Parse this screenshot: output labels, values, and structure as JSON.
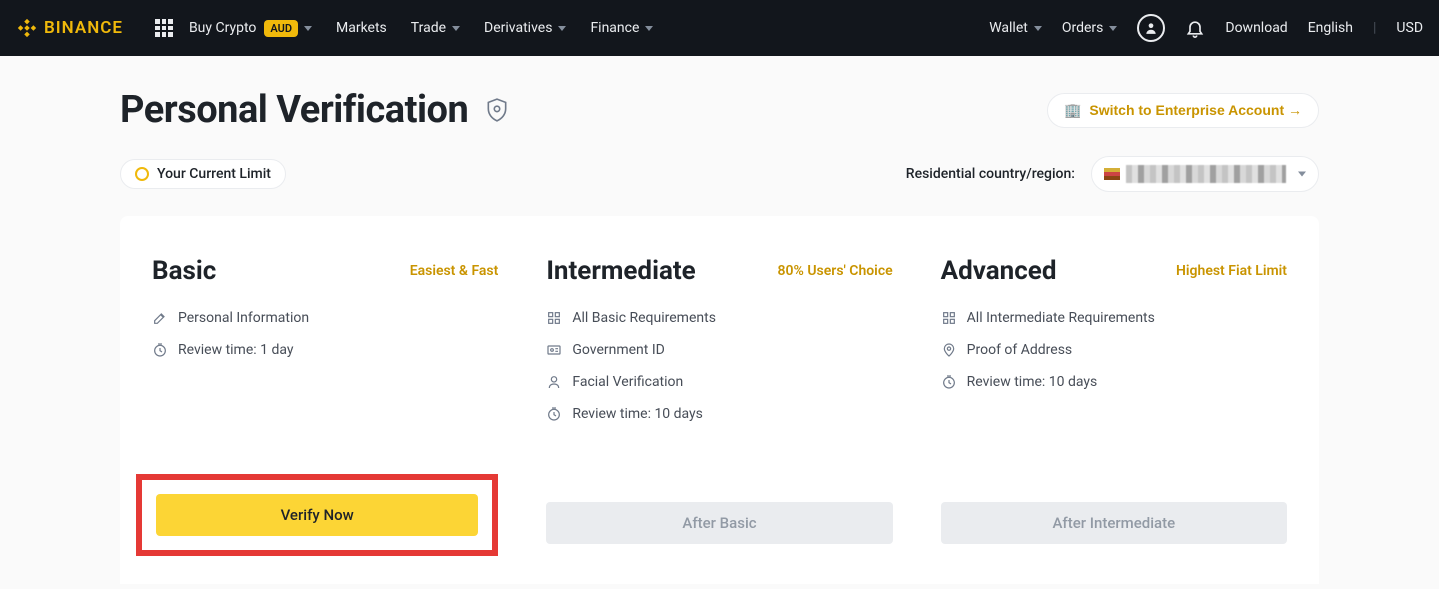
{
  "header": {
    "brand": "BINANCE",
    "nav_left": [
      {
        "label": "Buy Crypto",
        "badge": "AUD",
        "caret": true
      },
      {
        "label": "Markets",
        "caret": false
      },
      {
        "label": "Trade",
        "caret": true
      },
      {
        "label": "Derivatives",
        "caret": true
      },
      {
        "label": "Finance",
        "caret": true
      }
    ],
    "nav_right": {
      "wallet": "Wallet",
      "orders": "Orders",
      "download": "Download",
      "language": "English",
      "currency": "USD"
    }
  },
  "page": {
    "title": "Personal Verification",
    "enterprise_btn": "Switch to Enterprise Account →",
    "current_limit": "Your Current Limit",
    "country_label": "Residential country/region:"
  },
  "tiers": [
    {
      "title": "Basic",
      "tag": "Easiest & Fast",
      "reqs": [
        {
          "icon": "edit",
          "text": "Personal Information"
        },
        {
          "icon": "clock",
          "text": "Review time: 1 day"
        }
      ],
      "btn": "Verify Now",
      "btn_type": "primary",
      "highlight": true
    },
    {
      "title": "Intermediate",
      "tag": "80% Users' Choice",
      "reqs": [
        {
          "icon": "grid",
          "text": "All Basic Requirements"
        },
        {
          "icon": "id",
          "text": "Government ID"
        },
        {
          "icon": "face",
          "text": "Facial Verification"
        },
        {
          "icon": "clock",
          "text": "Review time: 10 days"
        }
      ],
      "btn": "After Basic",
      "btn_type": "disabled"
    },
    {
      "title": "Advanced",
      "tag": "Highest Fiat Limit",
      "reqs": [
        {
          "icon": "grid",
          "text": "All Intermediate Requirements"
        },
        {
          "icon": "pin",
          "text": "Proof of Address"
        },
        {
          "icon": "clock",
          "text": "Review time: 10 days"
        }
      ],
      "btn": "After Intermediate",
      "btn_type": "disabled"
    }
  ]
}
